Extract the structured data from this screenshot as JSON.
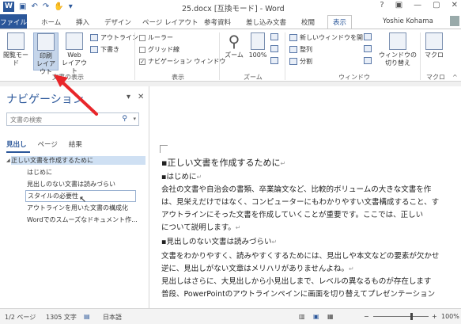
{
  "window": {
    "title": "25.docx [互換モード] - Word",
    "controls": [
      "?",
      "▣",
      "—",
      "▢",
      "✕"
    ]
  },
  "tabs": {
    "file": "ファイル",
    "home": "ホーム",
    "insert": "挿入",
    "design": "デザイン",
    "page_layout": "ページ レイアウト",
    "references": "参考資料",
    "mailings": "差し込み文書",
    "review": "校閲",
    "view": "表示",
    "user": "Yoshie Kohama"
  },
  "ribbon": {
    "read_mode": "閲覧モード",
    "print_layout_1": "印刷",
    "print_layout_2": "レイアウト",
    "web_layout_1": "Web",
    "web_layout_2": "レイアウト",
    "outline": "アウトライン",
    "draft": "下書き",
    "group_views": "文書の表示",
    "ruler": "ルーラー",
    "gridlines": "グリッド線",
    "nav_pane": "ナビゲーション ウィンドウ",
    "ruler_checked": false,
    "gridlines_checked": false,
    "nav_pane_checked": true,
    "group_show": "表示",
    "zoom": "ズーム",
    "zoom100": "100%",
    "group_zoom": "ズーム",
    "new_window": "新しいウィンドウを開く",
    "arrange": "整列",
    "split": "分割",
    "switch_windows_1": "ウィンドウの",
    "switch_windows_2": "切り替え",
    "group_window": "ウィンドウ",
    "macros": "マクロ",
    "group_macros": "マクロ"
  },
  "nav": {
    "title": "ナビゲーション",
    "search_placeholder": "文書の検索",
    "tab_headings": "見出し",
    "tab_pages": "ページ",
    "tab_results": "結果",
    "headings": [
      "正しい文書を作成するために",
      "はじめに",
      "見出しのない文書は読みづらい",
      "スタイルの必要性",
      "アウトラインを用いた文書の構成化",
      "Wordでのスムーズなドキュメント作..."
    ]
  },
  "document": {
    "lines": [
      "正しい文書を作成するために",
      "はじめに",
      "会社の文書や自治会の書類、卒業論文など、比較的ボリュームの大きな文書を作",
      "は、見栄えだけではなく、コンピューターにもわかりやすい文書構成すること、す",
      "アウトラインにそった文書を作成していくことが重要です。ここでは、正しい",
      "について説明します。",
      "見出しのない文書は読みづらい",
      "文書をわかりやすく、読みやすくするためには、見出しや本文などの要素が欠かせ",
      "逆に、見出しがない文章はメリハリがありませんよね。",
      "見出しはさらに、大見出しから小見出しまで、レベルの異なるものが存在します",
      "普段、PowerPointのアウトラインペインに画面を切り替えてプレゼンテーション"
    ]
  },
  "status": {
    "page": "1/2 ページ",
    "words": "1305 文字",
    "language": "日本語",
    "zoom": "100%",
    "zoom_value": 100
  },
  "colors": {
    "accent": "#2b579a",
    "annotation_arrow": "#e8262a"
  }
}
